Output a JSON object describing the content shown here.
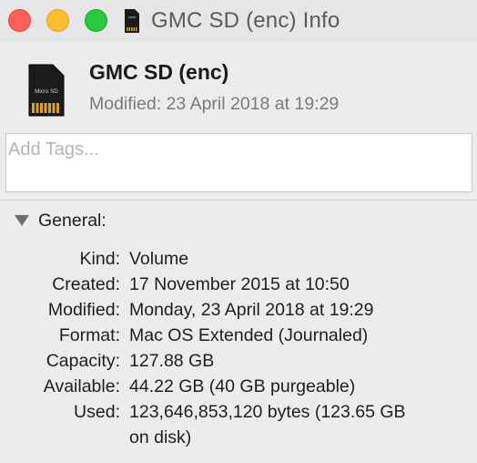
{
  "window": {
    "title": "GMC SD (enc) Info"
  },
  "header": {
    "name": "GMC SD (enc)",
    "modified": "Modified: 23 April 2018 at 19:29",
    "icon_label": "Micro SD"
  },
  "tags": {
    "placeholder": "Add Tags...",
    "value": ""
  },
  "general": {
    "title": "General:",
    "rows": [
      {
        "label": "Kind:",
        "value": "Volume"
      },
      {
        "label": "Created:",
        "value": "17 November 2015 at 10:50"
      },
      {
        "label": "Modified:",
        "value": "Monday, 23 April 2018 at 19:29"
      },
      {
        "label": "Format:",
        "value": "Mac OS Extended (Journaled)"
      },
      {
        "label": "Capacity:",
        "value": "127.88 GB"
      },
      {
        "label": "Available:",
        "value": "44.22 GB (40 GB purgeable)"
      },
      {
        "label": "Used:",
        "value": "123,646,853,120 bytes (123.65 GB on disk)"
      }
    ]
  },
  "colors": {
    "close": "#fe5f57",
    "minimize": "#febc2e",
    "zoom": "#28c840",
    "card_contacts": "#e0a020"
  }
}
